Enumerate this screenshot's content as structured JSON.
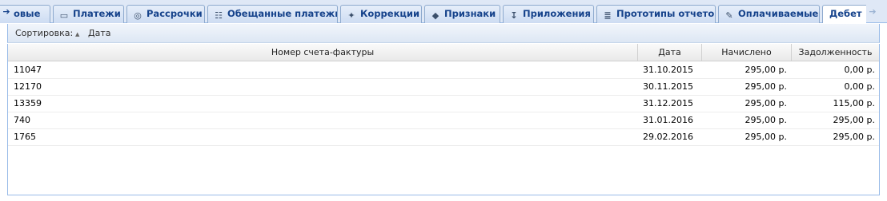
{
  "tabs": [
    {
      "label": "овые",
      "icon": "arrow-left-icon",
      "glyph": "←"
    },
    {
      "label": "Платежи",
      "icon": "payments-icon",
      "glyph": "▭"
    },
    {
      "label": "Рассрочки",
      "icon": "lifebuoy-icon",
      "glyph": "◎"
    },
    {
      "label": "Обещанные платежи",
      "icon": "promise-icon",
      "glyph": "☷"
    },
    {
      "label": "Коррекции",
      "icon": "wand-icon",
      "glyph": "✦"
    },
    {
      "label": "Признаки",
      "icon": "tag-icon",
      "glyph": "◆"
    },
    {
      "label": "Приложения",
      "icon": "attachment-icon",
      "glyph": "↧"
    },
    {
      "label": "Прототипы отчетов",
      "icon": "report-icon",
      "glyph": "≣"
    },
    {
      "label": "Оплачиваемые",
      "icon": "edit-document-icon",
      "glyph": "✎"
    },
    {
      "label": "Дебет",
      "icon": "",
      "glyph": ""
    }
  ],
  "toolbar": {
    "sort_label": "Сортировка:",
    "sort_field": "Дата"
  },
  "grid": {
    "columns": [
      "Номер счета-фактуры",
      "Дата",
      "Начислено",
      "Задолженность"
    ],
    "rows": [
      {
        "number": "11047",
        "date": "31.10.2015",
        "accrued": "295,00 р.",
        "debt": "0,00 р."
      },
      {
        "number": "12170",
        "date": "30.11.2015",
        "accrued": "295,00 р.",
        "debt": "0,00 р."
      },
      {
        "number": "13359",
        "date": "31.12.2015",
        "accrued": "295,00 р.",
        "debt": "115,00 р."
      },
      {
        "number": "740",
        "date": "31.01.2016",
        "accrued": "295,00 р.",
        "debt": "295,00 р."
      },
      {
        "number": "1765",
        "date": "29.02.2016",
        "accrued": "295,00 р.",
        "debt": "295,00 р."
      }
    ]
  }
}
